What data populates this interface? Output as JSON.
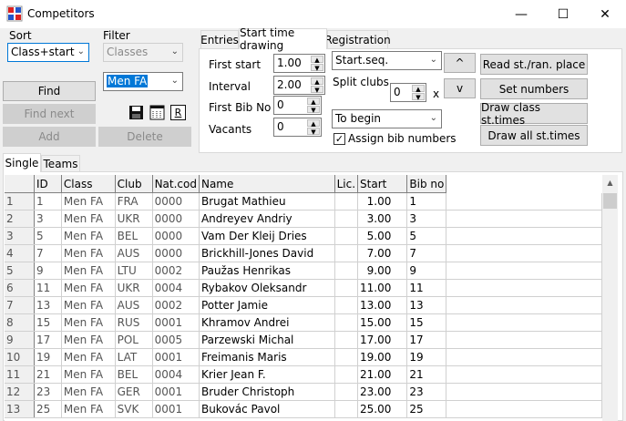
{
  "window": {
    "title": "Competitors",
    "minimize": "—",
    "maximize": "☐",
    "close": "✕"
  },
  "sort": {
    "label": "Sort",
    "value": "Class+start"
  },
  "filter": {
    "label": "Filter",
    "class_value": "Classes",
    "selected_value": "Men FA"
  },
  "buttons": {
    "find": "Find",
    "find_next": "Find next",
    "add": "Add",
    "delete": "Delete",
    "r": "R"
  },
  "tabs": {
    "entries": "Entries",
    "start_time": "Start time drawing",
    "registration": "Registration"
  },
  "start_panel": {
    "first_start_label": "First start",
    "first_start": "1.00",
    "interval_label": "Interval",
    "interval": "2.00",
    "first_bib_label": "First Bib No",
    "first_bib": "0",
    "vacants_label": "Vacants",
    "vacants": "0",
    "method_value": "Start.seq.",
    "split_clubs_label": "Split clubs",
    "split_clubs": "0",
    "x_label": "x",
    "position_value": "To begin",
    "assign_bib_label": "Assign bib numbers",
    "assign_bib_checked": "✓",
    "up_button": "^",
    "down_button": "v",
    "read_button": "Read st./ran. place",
    "set_numbers_button": "Set numbers",
    "draw_class_button": "Draw class st.times",
    "draw_all_button": "Draw all st.times"
  },
  "bottom_tabs": {
    "single": "Single",
    "teams": "Teams"
  },
  "table": {
    "headers": [
      "",
      "ID",
      "Class",
      "Club",
      "Nat.cod",
      "Name",
      "Lic.",
      "Start",
      "Bib no"
    ],
    "rows": [
      [
        "1",
        "1",
        "Men FA",
        "FRA",
        "0000",
        "Brugat Mathieu",
        "",
        "1.00",
        "1"
      ],
      [
        "2",
        "3",
        "Men FA",
        "UKR",
        "0000",
        "Andreyev Andriy",
        "",
        "3.00",
        "3"
      ],
      [
        "3",
        "5",
        "Men FA",
        "BEL",
        "0000",
        "Vam Der Kleij Dries",
        "",
        "5.00",
        "5"
      ],
      [
        "4",
        "7",
        "Men FA",
        "AUS",
        "0000",
        "Brickhill-Jones David",
        "",
        "7.00",
        "7"
      ],
      [
        "5",
        "9",
        "Men FA",
        "LTU",
        "0002",
        "Paužas Henrikas",
        "",
        "9.00",
        "9"
      ],
      [
        "6",
        "11",
        "Men FA",
        "UKR",
        "0004",
        "Rybakov Oleksandr",
        "",
        "11.00",
        "11"
      ],
      [
        "7",
        "13",
        "Men FA",
        "AUS",
        "0002",
        "Potter Jamie",
        "",
        "13.00",
        "13"
      ],
      [
        "8",
        "15",
        "Men FA",
        "RUS",
        "0001",
        "Khramov Andrei",
        "",
        "15.00",
        "15"
      ],
      [
        "9",
        "17",
        "Men FA",
        "POL",
        "0005",
        "Parzewski Michal",
        "",
        "17.00",
        "17"
      ],
      [
        "10",
        "19",
        "Men FA",
        "LAT",
        "0001",
        "Freimanis Maris",
        "",
        "19.00",
        "19"
      ],
      [
        "11",
        "21",
        "Men FA",
        "BEL",
        "0004",
        "Krier Jean F.",
        "",
        "21.00",
        "21"
      ],
      [
        "12",
        "23",
        "Men FA",
        "GER",
        "0001",
        "Bruder Christoph",
        "",
        "23.00",
        "23"
      ],
      [
        "13",
        "25",
        "Men FA",
        "SVK",
        "0001",
        "Bukovác Pavol",
        "",
        "25.00",
        "25"
      ]
    ]
  }
}
